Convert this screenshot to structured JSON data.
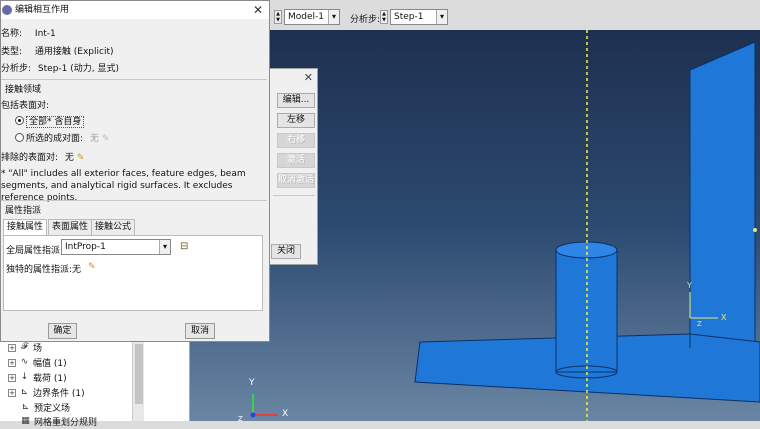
{
  "toolbar": {
    "model_value": "Model-1",
    "step_label": "分析步:",
    "step_value": "Step-1"
  },
  "dialog": {
    "title": "编辑相互作用",
    "name_label": "名称:",
    "name_value": "Int-1",
    "type_label": "类型:",
    "type_value": "通用接触 (Explicit)",
    "step_label": "分析步:",
    "step_value": "Step-1 (动力, 显式)",
    "contact_domain_header": "接触领域",
    "included_pairs_label": "包括表面对:",
    "all_option": "全部* 含自身",
    "selected_option": "所选的成对面:",
    "selected_value": "无",
    "excluded_label": "排除的表面对:",
    "excluded_value": "无",
    "note": "* \"All\" includes all exterior faces, feature edges, beam segments, and analytical rigid surfaces. It excludes reference points.",
    "attr_header": "属性指派",
    "tabs": [
      "接触属性",
      "表面属性",
      "接触公式"
    ],
    "global_prop_label": "全局属性指派:",
    "global_prop_value": "IntProp-1",
    "individual_label": "独特的属性指派:",
    "individual_value": "无",
    "ok_label": "确定",
    "cancel_label": "取消"
  },
  "manager": {
    "edit_label": "编辑...",
    "left_label": "左移",
    "right_label": "右移",
    "activate_label": "激活",
    "deactivate_label": "取消激活",
    "close_label": "关闭"
  },
  "tree": {
    "items": [
      {
        "icon": "𝓕",
        "label": "场"
      },
      {
        "icon": "∿",
        "label": "幅值 (1)"
      },
      {
        "icon": "↓",
        "label": "载荷 (1)"
      },
      {
        "icon": "⊾",
        "label": "边界条件 (1)"
      },
      {
        "icon": "⊾",
        "label": "预定义场"
      },
      {
        "icon": "▦",
        "label": "网格重划分规则"
      }
    ]
  },
  "viewport": {
    "axis_y": "Y",
    "axis_x": "X",
    "axis_z": "Z",
    "colors": {
      "model": "#1f78d8",
      "edge": "#0a2f6a",
      "axis_line": "#f0f04a"
    }
  }
}
